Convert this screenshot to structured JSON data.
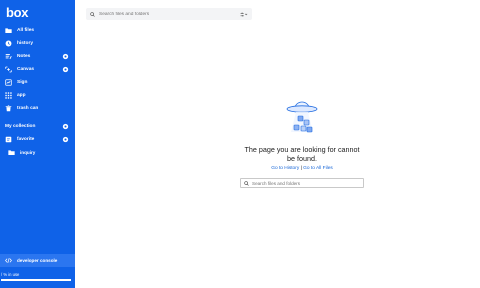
{
  "app": {
    "logo": "box"
  },
  "sidebar": {
    "items": [
      {
        "label": "All files",
        "icon": "folder-icon",
        "settings": false
      },
      {
        "label": "history",
        "icon": "clock-icon",
        "settings": false
      },
      {
        "label": "Notes",
        "icon": "notes-icon",
        "settings": true
      },
      {
        "label": "Canvas",
        "icon": "canvas-icon",
        "settings": true
      },
      {
        "label": "Sign",
        "icon": "sign-icon",
        "settings": false
      },
      {
        "label": "app",
        "icon": "grid-icon",
        "settings": false
      },
      {
        "label": "trash can",
        "icon": "trash-icon",
        "settings": false
      }
    ],
    "collection_title": "My collection",
    "favorite_label": "favorite",
    "inquiry_label": "inquiry",
    "developer_console": "developer console",
    "storage_text": "/ % in use",
    "storage_fraction": 1.0
  },
  "top_search": {
    "placeholder": "Search files and folders"
  },
  "main": {
    "message": "The page you are looking for cannot be found.",
    "link_history": "Go to History",
    "link_separator": "|",
    "link_allfiles": "Go to All Files",
    "search_placeholder": "Search files and folders"
  },
  "colors": {
    "sidebar": "#0f62e8",
    "link": "#1565d8"
  }
}
